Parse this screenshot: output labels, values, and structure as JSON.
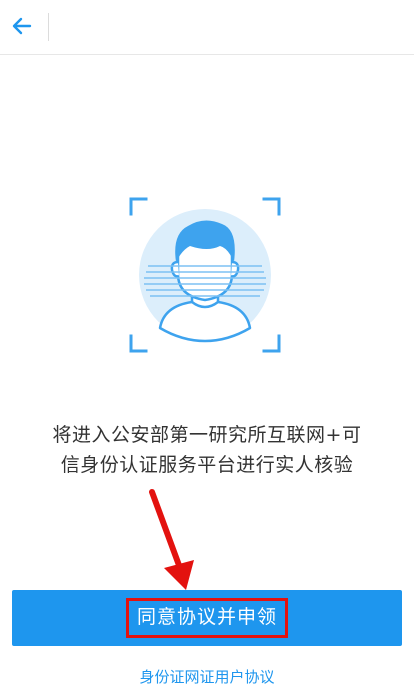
{
  "header": {
    "back_icon": "arrow-left-icon"
  },
  "illustration": {
    "icon": "face-scan-icon",
    "accent_color": "#3ea3ee"
  },
  "message": {
    "line1": "将进入公安部第一研究所互联网+可",
    "line2": "信身份认证服务平台进行实人核验"
  },
  "annotation": {
    "icon": "red-arrow-icon",
    "color": "#e3120f"
  },
  "agree_button": {
    "label": "同意协议并申领",
    "background": "#1e96ee"
  },
  "protocol_link": {
    "label": "身份证网证用户协议"
  }
}
